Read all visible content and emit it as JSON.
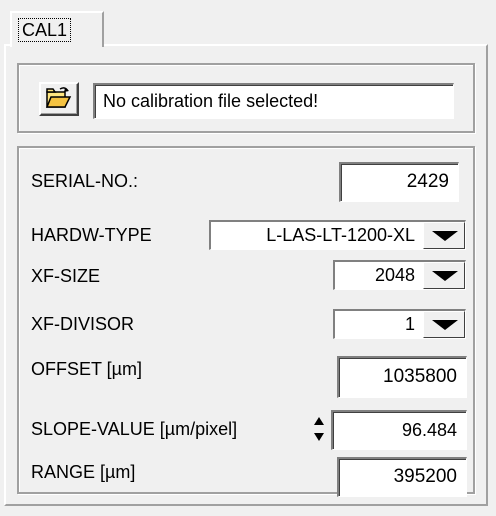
{
  "tab": {
    "label": "CAL1"
  },
  "file": {
    "status": "No calibration file selected!"
  },
  "settings": {
    "serial_label": "SERIAL-NO.:",
    "serial_value": "2429",
    "hardw_label": "HARDW-TYPE",
    "hardw_value": "L-LAS-LT-1200-XL",
    "xfsize_label": "XF-SIZE",
    "xfsize_value": "2048",
    "xfdivisor_label": "XF-DIVISOR",
    "xfdivisor_value": "1",
    "offset_label": "OFFSET  [µm]",
    "offset_value": "1035800",
    "slope_label": "SLOPE-VALUE [µm/pixel]",
    "slope_value": "96.484",
    "range_label": "RANGE  [µm]",
    "range_value": "395200"
  },
  "icons": {
    "open": "open-folder-icon",
    "dropdown": "dropdown-arrow-icon",
    "spinner": "spinner-arrows-icon"
  }
}
